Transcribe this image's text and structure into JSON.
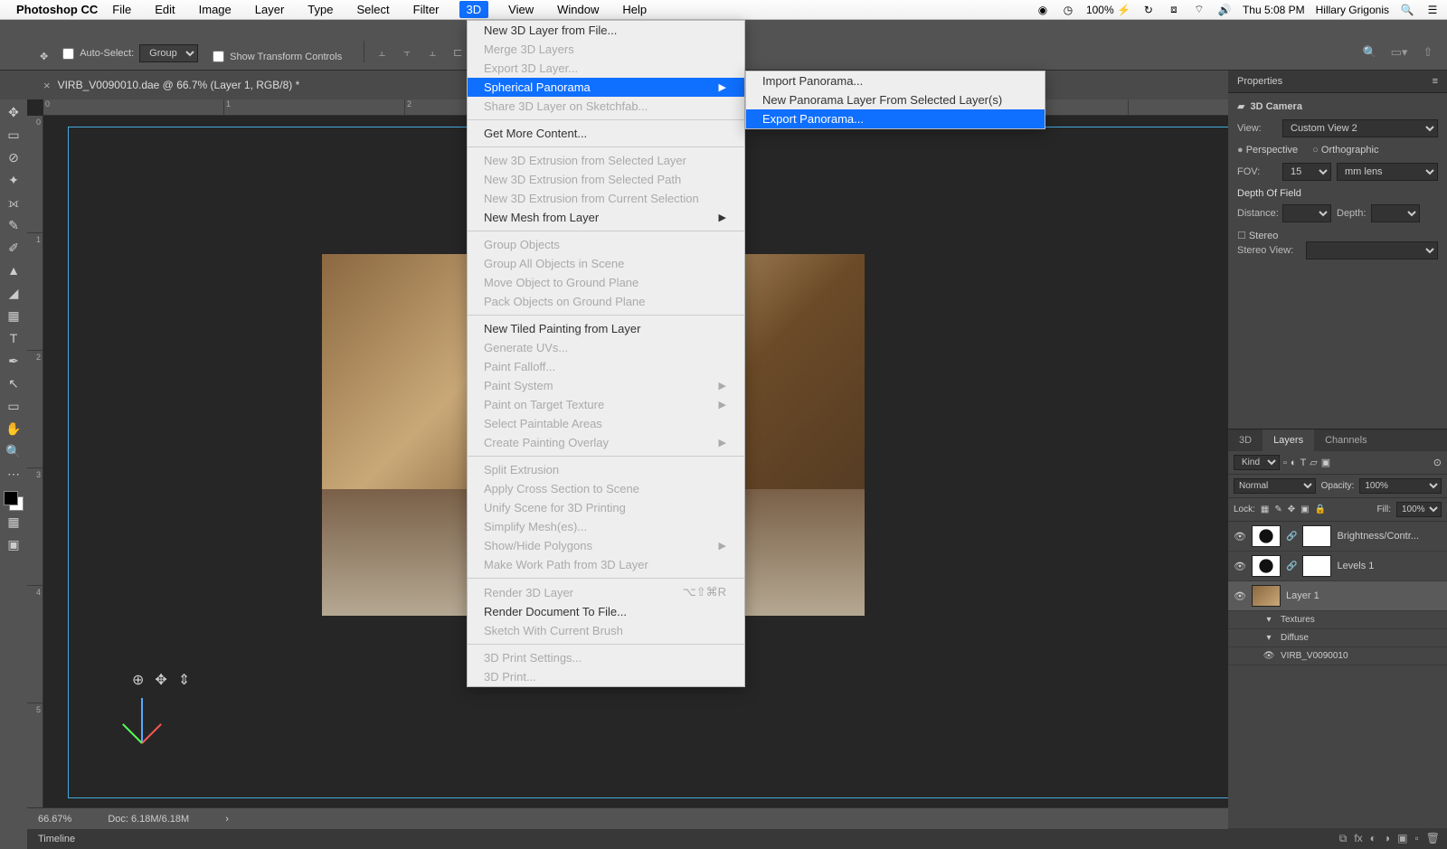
{
  "menubar": {
    "app": "Photoshop CC",
    "items": [
      "File",
      "Edit",
      "Image",
      "Layer",
      "Type",
      "Select",
      "Filter",
      "3D",
      "View",
      "Window",
      "Help"
    ],
    "active": "3D",
    "battery": "100%",
    "clock": "Thu 5:08 PM",
    "user": "Hillary Grigonis"
  },
  "options": {
    "autoselect": "Auto-Select:",
    "autoselect_mode": "Group",
    "show_transform": "Show Transform Controls"
  },
  "doc": {
    "title": "VIRB_V0090010.dae @ 66.7% (Layer 1, RGB/8) *",
    "zoom": "66.67%",
    "docinfo": "Doc: 6.18M/6.18M",
    "timeline": "Timeline"
  },
  "menu3d": [
    {
      "label": "New 3D Layer from File...",
      "enabled": true
    },
    {
      "label": "Merge 3D Layers",
      "enabled": false
    },
    {
      "label": "Export 3D Layer...",
      "enabled": false
    },
    {
      "label": "Spherical Panorama",
      "enabled": true,
      "sub": true,
      "hl": true
    },
    {
      "label": "Share 3D Layer on Sketchfab...",
      "enabled": false
    },
    {
      "sep": true
    },
    {
      "label": "Get More Content...",
      "enabled": true
    },
    {
      "sep": true
    },
    {
      "label": "New 3D Extrusion from Selected Layer",
      "enabled": false
    },
    {
      "label": "New 3D Extrusion from Selected Path",
      "enabled": false
    },
    {
      "label": "New 3D Extrusion from Current Selection",
      "enabled": false
    },
    {
      "label": "New Mesh from Layer",
      "enabled": true,
      "sub": true
    },
    {
      "sep": true
    },
    {
      "label": "Group Objects",
      "enabled": false
    },
    {
      "label": "Group All Objects in Scene",
      "enabled": false
    },
    {
      "label": "Move Object to Ground Plane",
      "enabled": false
    },
    {
      "label": "Pack Objects on Ground Plane",
      "enabled": false
    },
    {
      "sep": true
    },
    {
      "label": "New Tiled Painting from Layer",
      "enabled": true
    },
    {
      "label": "Generate UVs...",
      "enabled": false
    },
    {
      "label": "Paint Falloff...",
      "enabled": false
    },
    {
      "label": "Paint System",
      "enabled": false,
      "sub": true
    },
    {
      "label": "Paint on Target Texture",
      "enabled": false,
      "sub": true
    },
    {
      "label": "Select Paintable Areas",
      "enabled": false
    },
    {
      "label": "Create Painting Overlay",
      "enabled": false,
      "sub": true
    },
    {
      "sep": true
    },
    {
      "label": "Split Extrusion",
      "enabled": false
    },
    {
      "label": "Apply Cross Section to Scene",
      "enabled": false
    },
    {
      "label": "Unify Scene for 3D Printing",
      "enabled": false
    },
    {
      "label": "Simplify Mesh(es)...",
      "enabled": false
    },
    {
      "label": "Show/Hide Polygons",
      "enabled": false,
      "sub": true
    },
    {
      "label": "Make Work Path from 3D Layer",
      "enabled": false
    },
    {
      "sep": true
    },
    {
      "label": "Render 3D Layer",
      "enabled": false,
      "shortcut": "⌥⇧⌘R"
    },
    {
      "label": "Render Document To File...",
      "enabled": true
    },
    {
      "label": "Sketch With Current Brush",
      "enabled": false
    },
    {
      "sep": true
    },
    {
      "label": "3D Print Settings...",
      "enabled": false
    },
    {
      "label": "3D Print...",
      "enabled": false
    }
  ],
  "submenu": [
    {
      "label": "Import Panorama...",
      "enabled": true
    },
    {
      "label": "New Panorama Layer From Selected Layer(s)",
      "enabled": true
    },
    {
      "label": "Export Panorama...",
      "enabled": true,
      "hl": true
    }
  ],
  "properties": {
    "title": "Properties",
    "section": "3D Camera",
    "view_label": "View:",
    "view_value": "Custom View 2",
    "proj_perspective": "Perspective",
    "proj_ortho": "Orthographic",
    "fov_label": "FOV:",
    "fov_value": "15",
    "fov_unit": "mm lens",
    "dof": "Depth Of Field",
    "distance": "Distance:",
    "depth": "Depth:",
    "stereo": "Stereo",
    "stereo_view": "Stereo View:"
  },
  "layers": {
    "tabs": [
      "3D",
      "Layers",
      "Channels"
    ],
    "active_tab": "Layers",
    "kind": "Kind",
    "blend": "Normal",
    "opacity_label": "Opacity:",
    "opacity": "100%",
    "lock_label": "Lock:",
    "fill_label": "Fill:",
    "fill": "100%",
    "items": [
      {
        "name": "Brightness/Contr...",
        "type": "adj"
      },
      {
        "name": "Levels 1",
        "type": "adj"
      },
      {
        "name": "Layer 1",
        "type": "img",
        "selected": true
      },
      {
        "name": "Textures",
        "type": "sub"
      },
      {
        "name": "Diffuse",
        "type": "sub"
      },
      {
        "name": "VIRB_V0090010",
        "type": "sub",
        "eye": true
      }
    ]
  }
}
